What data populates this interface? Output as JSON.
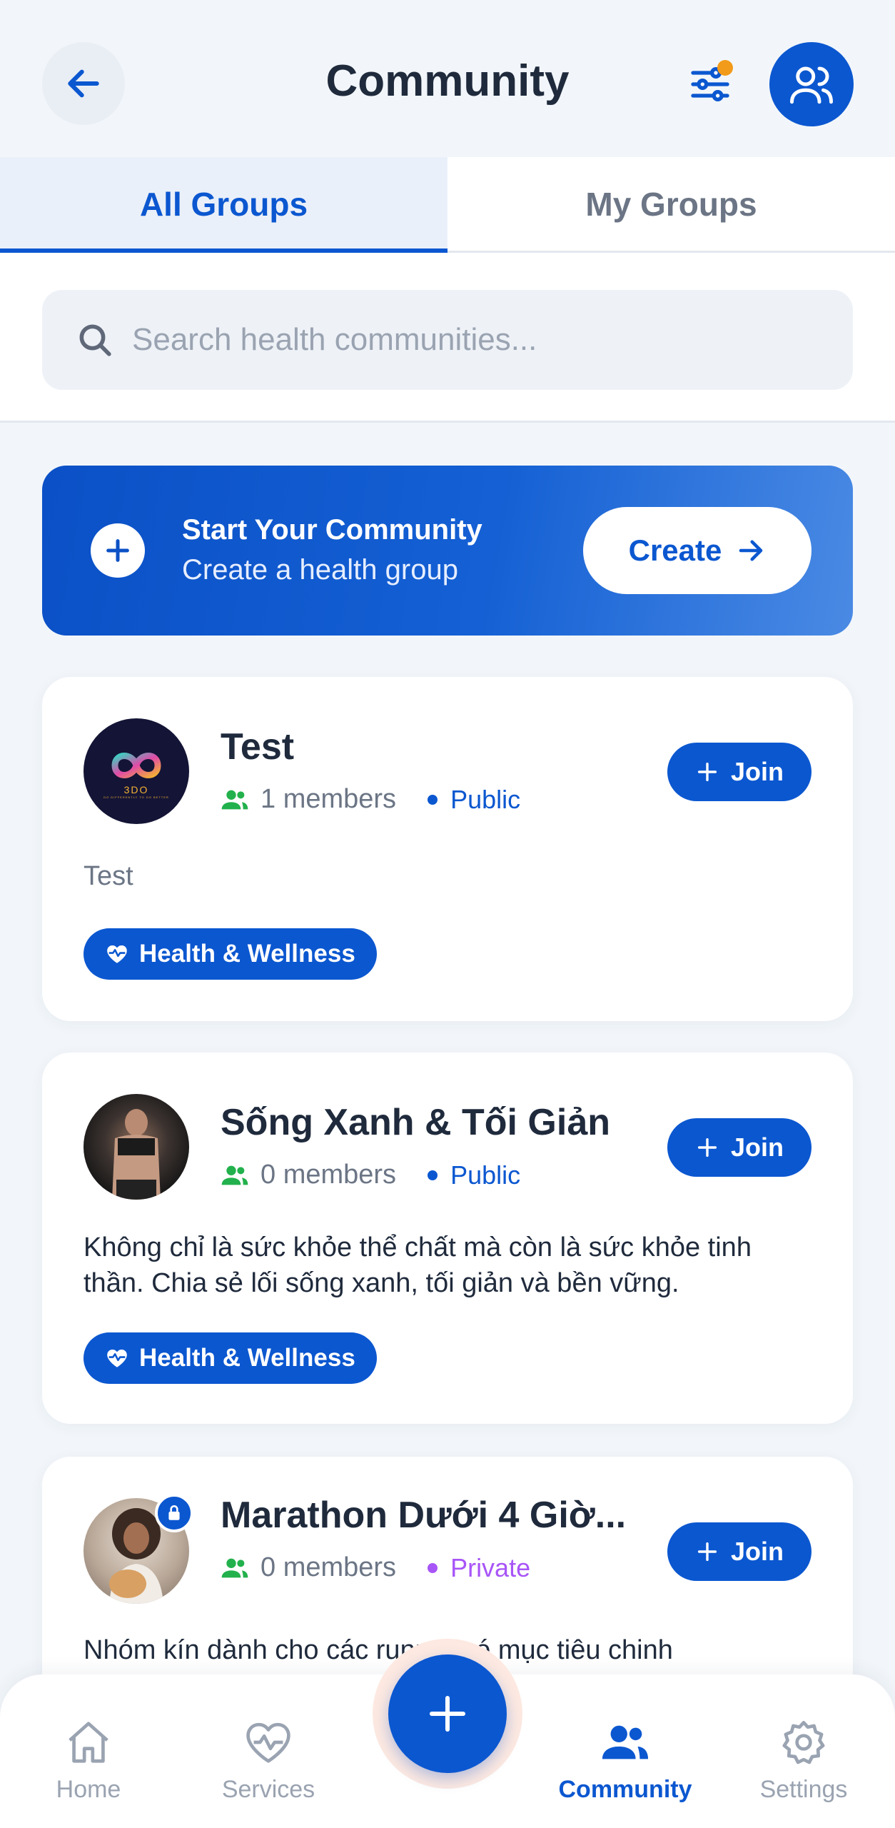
{
  "header": {
    "title": "Community",
    "back_icon": "arrow-left-icon",
    "filter_icon": "sliders-icon",
    "groups_icon": "users-icon"
  },
  "tabs": [
    {
      "label": "All Groups",
      "active": true
    },
    {
      "label": "My Groups",
      "active": false
    }
  ],
  "search": {
    "placeholder": "Search health communities...",
    "value": ""
  },
  "banner": {
    "title": "Start Your Community",
    "subtitle": "Create a health group",
    "button_label": "Create"
  },
  "groups": [
    {
      "name": "Test",
      "members": "1 members",
      "visibility": "Public",
      "description": "Test",
      "tag": "Health & Wellness",
      "join_label": "Join",
      "avatar_text": "3DO",
      "avatar_subtext": "DO DIFFERENTLY TO DO BETTER"
    },
    {
      "name": "Sống Xanh & Tối Giản",
      "members": "0 members",
      "visibility": "Public",
      "description": "Không chỉ là sức khỏe thể chất mà còn là sức khỏe tinh thần. Chia sẻ lối sống xanh, tối giản và bền vững.",
      "tag": "Health & Wellness",
      "join_label": "Join"
    },
    {
      "name": "Marathon Dưới 4 Giờ...",
      "members": "0 members",
      "visibility": "Private",
      "description": "Nhóm kín dành cho các runner có mục tiêu chinh",
      "join_label": "Join"
    }
  ],
  "nav": [
    {
      "label": "Home",
      "icon": "home-icon",
      "active": false
    },
    {
      "label": "Services",
      "icon": "heart-pulse-icon",
      "active": false
    },
    {
      "label": "Community",
      "icon": "users-icon",
      "active": true
    },
    {
      "label": "Settings",
      "icon": "gear-icon",
      "active": false
    }
  ],
  "colors": {
    "primary": "#0b57d0",
    "public": "#0b57d0",
    "private": "#a855f7",
    "members_icon": "#22b14c",
    "filter_dot": "#f29a1a"
  }
}
